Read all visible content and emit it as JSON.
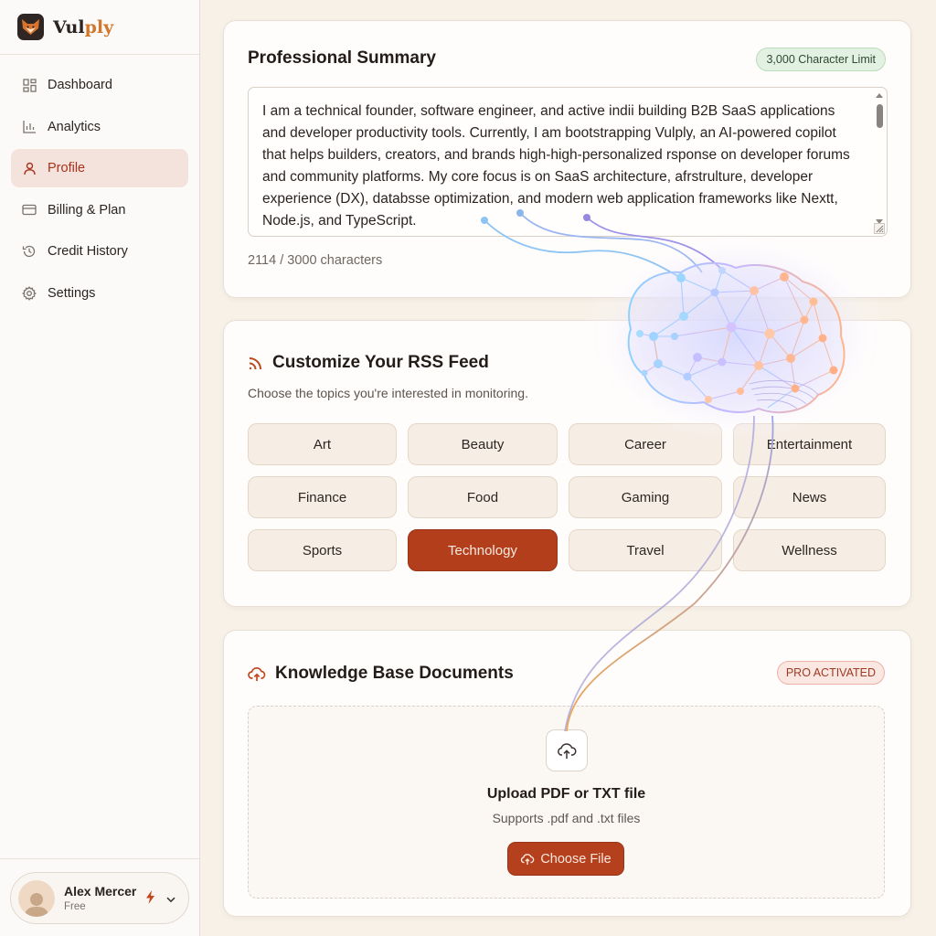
{
  "app": {
    "name_main": "Vul",
    "name_accent": "ply",
    "logo_icon": "fox-icon"
  },
  "sidebar": {
    "items": [
      {
        "label": "Dashboard",
        "icon": "dashboard-grid-icon",
        "active": false
      },
      {
        "label": "Analytics",
        "icon": "bar-chart-icon",
        "active": false
      },
      {
        "label": "Profile",
        "icon": "user-icon",
        "active": true
      },
      {
        "label": "Billing & Plan",
        "icon": "credit-card-icon",
        "active": false
      },
      {
        "label": "Credit History",
        "icon": "history-icon",
        "active": false
      },
      {
        "label": "Settings",
        "icon": "gear-icon",
        "active": false
      }
    ],
    "user": {
      "name": "Alex Mercer",
      "plan": "Free"
    }
  },
  "summary": {
    "title": "Professional Summary",
    "limit_badge": "3,000 Character Limit",
    "text": "I am a technical founder, software engineer, and active indii building B2B SaaS applications and developer productivity tools. Currently, I am bootstrapping Vulply, an AI-powered copilot that helps builders, creators, and brands high-high-personalized rsponse on developer forums and community platforms. My core focus is on SaaS architecture, afrstrulture, developer experience (DX), databsse optimization, and modern web application frameworks like Nextt, Node.js, and TypeScript.",
    "char_count": "2114 / 3000 characters"
  },
  "rss": {
    "title": "Customize Your RSS Feed",
    "subtitle": "Choose the topics you're interested in monitoring.",
    "topics": [
      {
        "label": "Art",
        "selected": false
      },
      {
        "label": "Beauty",
        "selected": false
      },
      {
        "label": "Career",
        "selected": false
      },
      {
        "label": "Entertainment",
        "selected": false
      },
      {
        "label": "Finance",
        "selected": false
      },
      {
        "label": "Food",
        "selected": false
      },
      {
        "label": "Gaming",
        "selected": false
      },
      {
        "label": "News",
        "selected": false
      },
      {
        "label": "Sports",
        "selected": false
      },
      {
        "label": "Technology",
        "selected": true
      },
      {
        "label": "Travel",
        "selected": false
      },
      {
        "label": "Wellness",
        "selected": false
      }
    ]
  },
  "knowledge": {
    "title": "Knowledge Base Documents",
    "badge": "PRO ACTIVATED",
    "upload_title": "Upload PDF or TXT file",
    "upload_sub": "Supports .pdf and .txt files",
    "button_label": "Choose File"
  },
  "colors": {
    "accent": "#b5401d",
    "page_bg": "#f7f1e8",
    "active_nav_bg": "#f4e3dc",
    "limit_badge_bg": "#e3f1e3",
    "pro_badge_bg": "#fbe7e2"
  }
}
